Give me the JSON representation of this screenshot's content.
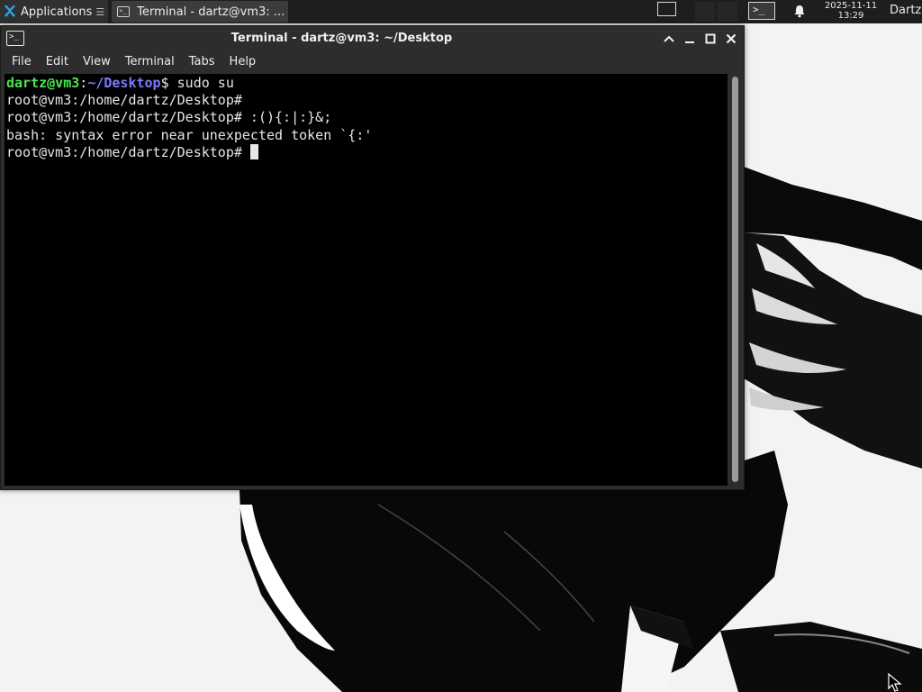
{
  "panel": {
    "applications_label": "Applications",
    "applications_icon": "xfce-logo-icon",
    "task_icon": "terminal-icon",
    "task_label": "Terminal - dartz@vm3: ...",
    "tray_terminal_icon": ">_",
    "notification_icon": "bell-icon",
    "clock_date": "2025-11-11",
    "clock_time": "13:29",
    "user_name": "Dartz"
  },
  "window": {
    "title_icon": ">_",
    "title": "Terminal - dartz@vm3: ~/Desktop",
    "controls": [
      "chevron-up-icon",
      "minimize-icon",
      "maximize-icon",
      "close-icon"
    ]
  },
  "menu": {
    "items": [
      {
        "label": "File"
      },
      {
        "label": "Edit"
      },
      {
        "label": "View"
      },
      {
        "label": "Terminal"
      },
      {
        "label": "Tabs"
      },
      {
        "label": "Help"
      }
    ]
  },
  "terminal": {
    "line1_user": "dartz@vm3",
    "line1_colon": ":",
    "line1_path": "~/Desktop",
    "line1_cmd": "$ sudo su",
    "line2": "root@vm3:/home/dartz/Desktop# ",
    "line3": "root@vm3:/home/dartz/Desktop# :(){:|:}&;",
    "line4": "bash: syntax error near unexpected token `{:'",
    "line5": "root@vm3:/home/dartz/Desktop# "
  },
  "colors": {
    "panel_bg": "#1e1e1e",
    "window_bg": "#2d2d2d",
    "terminal_bg": "#000000",
    "prompt_user": "#4ee64e",
    "prompt_path": "#7b7bff"
  }
}
